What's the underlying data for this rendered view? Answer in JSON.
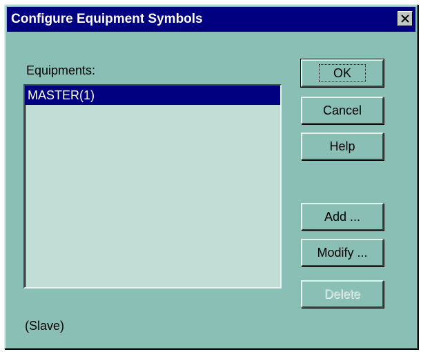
{
  "window": {
    "title": "Configure Equipment Symbols",
    "close_label": "Close"
  },
  "equipments": {
    "label": "Equipments:",
    "items": [
      "MASTER(1)"
    ],
    "selected_index": 0
  },
  "buttons": {
    "ok": "OK",
    "cancel": "Cancel",
    "help": "Help",
    "add": "Add ...",
    "modify": "Modify ...",
    "delete": "Delete"
  },
  "status_text": "(Slave)",
  "colors": {
    "dialog_face": "#89bfb4",
    "titlebar": "#000080",
    "listbox_bg": "#c2ddd5",
    "selection": "#000080"
  },
  "icons": {
    "close": "close-icon"
  }
}
